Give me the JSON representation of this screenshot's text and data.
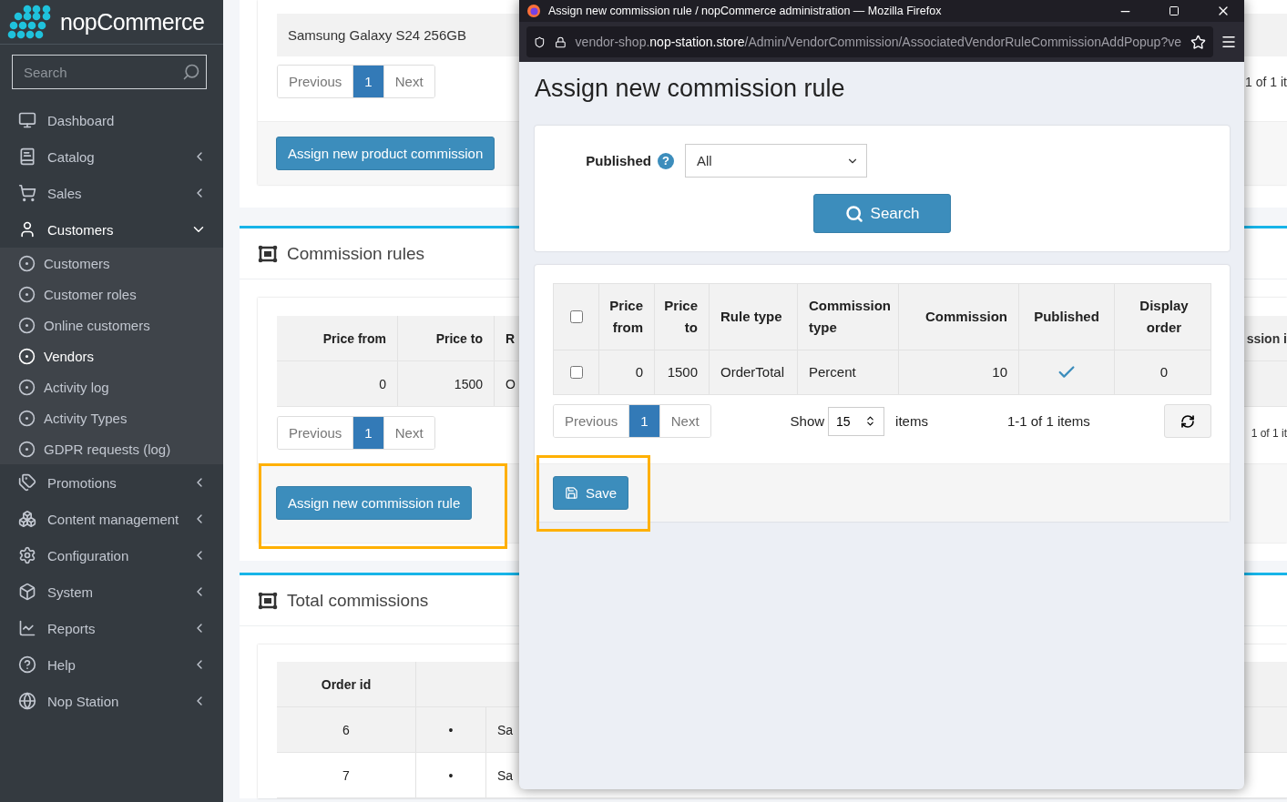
{
  "sidebar": {
    "logo": "nopCommerce",
    "search": {
      "placeholder": "Search"
    },
    "items": [
      {
        "label": "Dashboard"
      },
      {
        "label": "Catalog",
        "expanded": false
      },
      {
        "label": "Sales",
        "expanded": false
      },
      {
        "label": "Customers",
        "expanded": true,
        "children": [
          {
            "label": "Customers",
            "selected": false
          },
          {
            "label": "Customer roles",
            "selected": false
          },
          {
            "label": "Online customers",
            "selected": false
          },
          {
            "label": "Vendors",
            "selected": true
          },
          {
            "label": "Activity log",
            "selected": false
          },
          {
            "label": "Activity Types",
            "selected": false
          },
          {
            "label": "GDPR requests (log)",
            "selected": false
          }
        ]
      },
      {
        "label": "Promotions",
        "expanded": false
      },
      {
        "label": "Content management",
        "expanded": false
      },
      {
        "label": "Configuration",
        "expanded": false
      },
      {
        "label": "System",
        "expanded": false
      },
      {
        "label": "Reports",
        "expanded": false
      },
      {
        "label": "Help",
        "expanded": false
      },
      {
        "label": "Nop Station",
        "expanded": false
      }
    ]
  },
  "page": {
    "product_commissions": {
      "rows": [
        "Samsung Galaxy S24 256GB"
      ],
      "pager": {
        "previous": "Previous",
        "pages": [
          {
            "label": "1",
            "selected": true
          }
        ],
        "next": "Next"
      },
      "summary": "1 of 1 it",
      "button": "Assign new product commission"
    },
    "commission_rules": {
      "title": "Commission rules",
      "columns": [
        "Price from",
        "Price to",
        "R"
      ],
      "column_right": "ssion i",
      "rows": [
        [
          "0",
          "1500",
          "O"
        ]
      ],
      "pager": {
        "previous": "Previous",
        "pages": [
          {
            "label": "1",
            "selected": true
          }
        ],
        "next": "Next"
      },
      "summary": "1 of 1 it",
      "button": "Assign new commission rule",
      "highlighted": true
    },
    "total_commissions": {
      "title": "Total commissions",
      "columns": [
        "Order id"
      ],
      "rows": [
        [
          "6",
          "•",
          "Sa"
        ],
        [
          "7",
          "•",
          "Sa"
        ]
      ]
    }
  },
  "popup": {
    "window_title": "Assign new commission rule / nopCommerce administration — Mozilla Firefox",
    "url": {
      "prefix": "vendor-shop.",
      "host": "nop-station.store",
      "path": "/Admin/VendorCommission/AssociatedVendorRuleCommissionAddPopup?ve"
    },
    "heading": "Assign new commission rule",
    "filter": {
      "label": "Published",
      "hint": "?",
      "value": "All",
      "search_button": "Search"
    },
    "table": {
      "header_checked": false,
      "columns": [
        "Price from",
        "Price to",
        "Rule type",
        "Commission type",
        "Commission",
        "Published",
        "Display order"
      ],
      "rows": [
        {
          "checked": false,
          "price_from": "0",
          "price_to": "1500",
          "rule_type": "OrderTotal",
          "commission_type": "Percent",
          "commission": "10",
          "published": true,
          "display_order": "0"
        }
      ]
    },
    "pager": {
      "previous": "Previous",
      "pages": [
        {
          "label": "1",
          "selected": true
        }
      ],
      "next": "Next"
    },
    "page_size": {
      "label": "Show",
      "value": "15",
      "suffix": "items"
    },
    "summary": "1-1 of 1 items",
    "save_button": "Save",
    "save_highlighted": true
  }
}
